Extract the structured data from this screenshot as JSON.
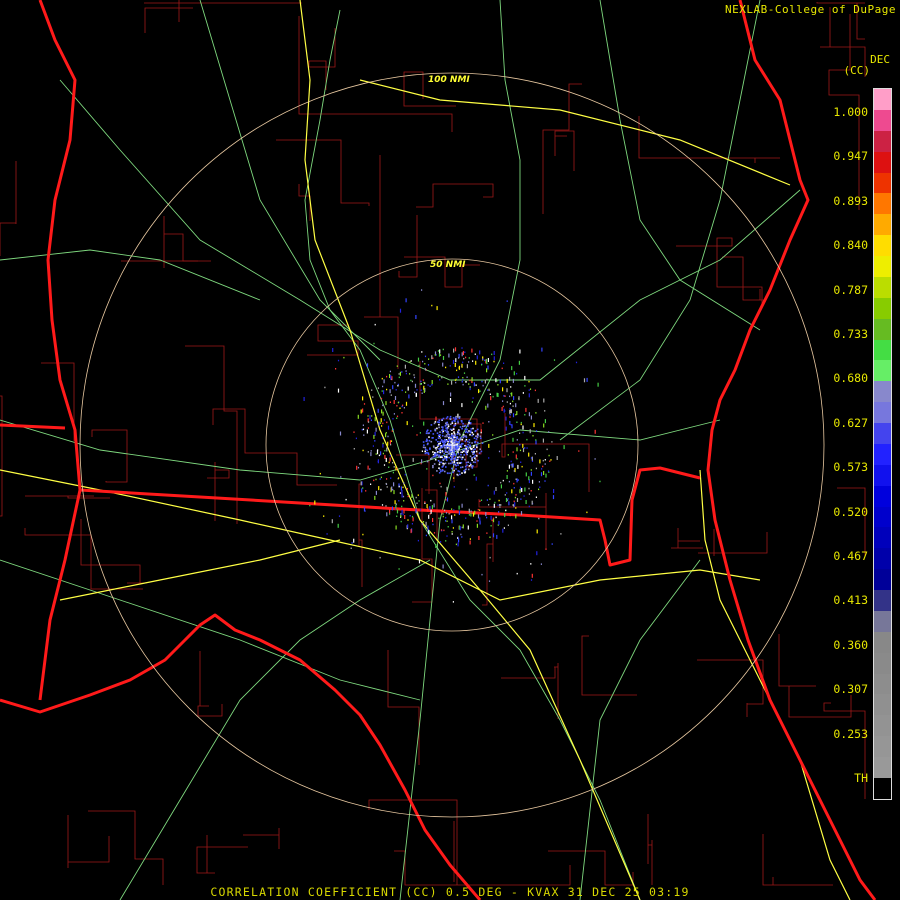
{
  "credit": "NEXLAB-College of DuPage",
  "units_line1": "DEC",
  "units_line2": "(CC)",
  "footer": "CORRELATION COEFFICIENT (CC) 0.5 DEG - KVAX 31 DEC 25 03:19",
  "range_rings": [
    {
      "label": "100 NMI"
    },
    {
      "label": "50 NMI"
    }
  ],
  "colors": {
    "state_border": "#ff1a1a",
    "county_line": "#a01818",
    "highway": "#ffff44",
    "road": "#88ee88",
    "range_ring": "#e8c8a0",
    "label": "#e8e800"
  },
  "colorbar": {
    "labels": [
      "1.000",
      "0.947",
      "0.893",
      "0.840",
      "0.787",
      "0.733",
      "0.680",
      "0.627",
      "0.573",
      "0.520",
      "0.467",
      "0.413",
      "0.360",
      "0.307",
      "0.253",
      "TH"
    ],
    "segments": [
      "#ff9ec8",
      "#ee4a90",
      "#cc2244",
      "#dd1111",
      "#ee3300",
      "#ff7700",
      "#ffaa00",
      "#ffdd00",
      "#eeee00",
      "#bbdd00",
      "#88cc00",
      "#66bb22",
      "#44dd44",
      "#66ee66",
      "#8888cc",
      "#7777dd",
      "#4444ee",
      "#2222ff",
      "#1111ee",
      "#0000dd",
      "#0000cc",
      "#0000bb",
      "#0000aa",
      "#000099",
      "#333388",
      "#777799",
      "#888888",
      "#8a8a8a",
      "#8d8d8d",
      "#909090",
      "#939393",
      "#969696",
      "#999999",
      "#000000"
    ]
  }
}
